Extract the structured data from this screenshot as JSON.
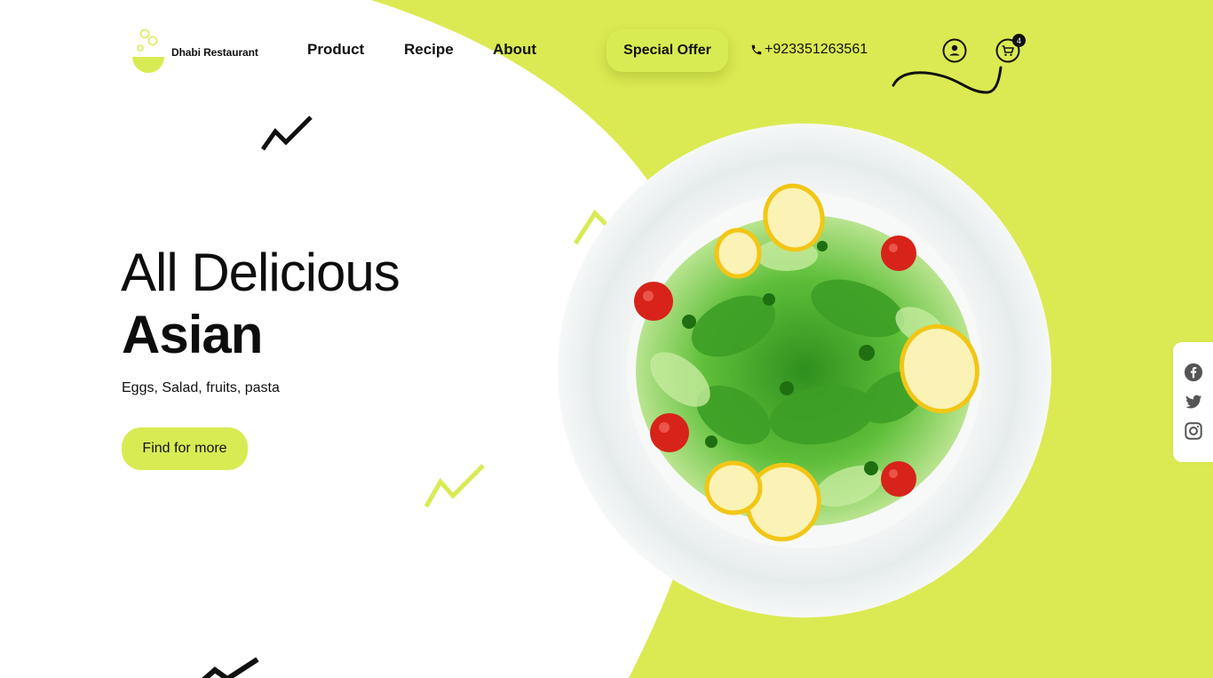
{
  "brand": {
    "name": "Dhabi Restaurant",
    "logo_icon": "bowl-bubbles-icon"
  },
  "nav": {
    "product": "Product",
    "recipe": "Recipe",
    "about": "About"
  },
  "header": {
    "special_offer": "Special Offer",
    "phone": "+923351263561",
    "phone_icon": "phone-icon",
    "user_icon": "user-circle-icon",
    "cart_icon": "cart-icon",
    "cart_count": "4"
  },
  "hero": {
    "line1": "All Delicious",
    "line2": "Asian",
    "subtitle": "Eggs, Salad, fruits, pasta",
    "cta_label": "Find for more",
    "image": "salad-plate"
  },
  "social": [
    {
      "icon": "facebook-icon"
    },
    {
      "icon": "twitter-icon"
    },
    {
      "icon": "instagram-icon"
    }
  ],
  "colors": {
    "accent": "#d9eb53",
    "text": "#0d0d0d",
    "background": "#ffffff"
  }
}
